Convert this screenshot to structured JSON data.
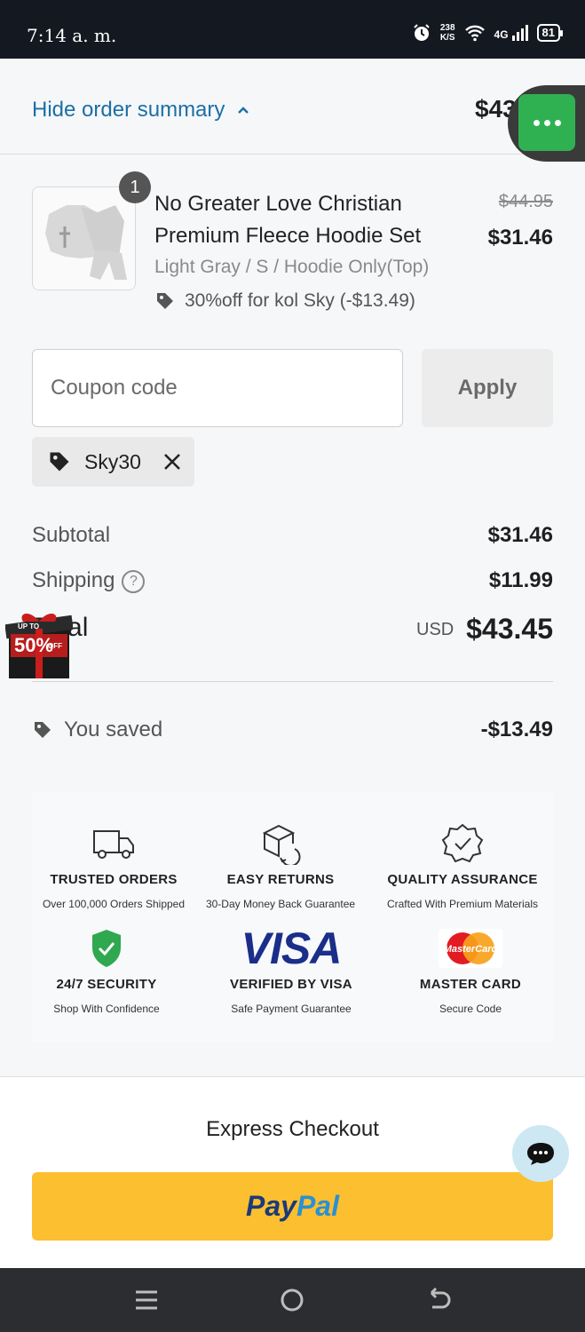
{
  "status_bar": {
    "time": "7:14 a. m.",
    "speed_value": "238",
    "speed_unit": "K/S",
    "network": "4G",
    "battery": "81"
  },
  "summary": {
    "toggle_label": "Hide order summary",
    "total": "$43"
  },
  "product": {
    "quantity": "1",
    "name": "No Greater Love Christian Premium Fleece Hoodie Set",
    "variant": "Light Gray / S / Hoodie Only(Top)",
    "discount": "30%off for kol Sky (-$13.49)",
    "original_price": "$44.95",
    "price": "$31.46"
  },
  "coupon": {
    "placeholder": "Coupon code",
    "apply_label": "Apply",
    "applied_code": "Sky30"
  },
  "totals": {
    "subtotal_label": "Subtotal",
    "subtotal": "$31.46",
    "shipping_label": "Shipping",
    "shipping": "$11.99",
    "total_label": "Total",
    "currency": "USD",
    "total": "$43.45",
    "saved_label": "You saved",
    "saved": "-$13.49"
  },
  "promo_badge": {
    "top_text": "UP TO",
    "big_text": "50%",
    "bottom_text": "OFF"
  },
  "badges": [
    {
      "title": "TRUSTED ORDERS",
      "subtitle": "Over 100,000 Orders Shipped",
      "icon": "truck-icon"
    },
    {
      "title": "EASY RETURNS",
      "subtitle": "30-Day Money Back Guarantee",
      "icon": "return-box-icon"
    },
    {
      "title": "QUALITY ASSURANCE",
      "subtitle": "Crafted With Premium Materials",
      "icon": "quality-seal-icon"
    },
    {
      "title": "24/7 SECURITY",
      "subtitle": "Shop With Confidence",
      "icon": "shield-check-icon"
    },
    {
      "title": "VERIFIED BY VISA",
      "subtitle": "Safe Payment Guarantee",
      "icon": "visa-logo"
    },
    {
      "title": "MASTER CARD",
      "subtitle": "Secure Code",
      "icon": "mastercard-logo"
    }
  ],
  "logos": {
    "visa": "VISA",
    "mastercard": "MasterCard"
  },
  "express": {
    "title": "Express Checkout",
    "paypal_pay": "Pay",
    "paypal_pal": "Pal"
  },
  "colors": {
    "link": "#1b6fa6",
    "paypal": "#fcbf2f",
    "menu_fab": "#2fb152",
    "status_bar": "#141820"
  }
}
